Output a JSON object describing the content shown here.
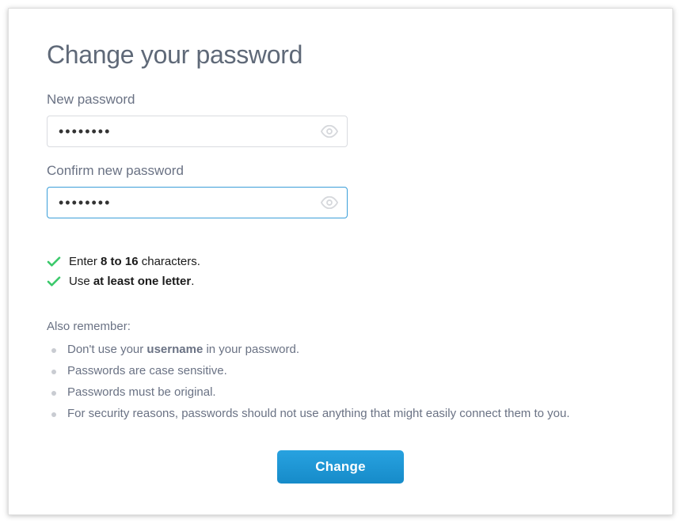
{
  "title": "Change your password",
  "fields": {
    "new_password": {
      "label": "New password",
      "value": "••••••••"
    },
    "confirm_password": {
      "label": "Confirm new password",
      "value": "••••••••"
    }
  },
  "rules": {
    "r1_pre": "Enter ",
    "r1_bold": "8 to 16",
    "r1_post": " characters.",
    "r2_pre": "Use ",
    "r2_bold": "at least one letter",
    "r2_post": "."
  },
  "remember": {
    "heading": "Also remember:",
    "tip1_pre": "Don't use your ",
    "tip1_bold": "username",
    "tip1_post": " in your password.",
    "tip2": "Passwords are case sensitive.",
    "tip3": "Passwords must be original.",
    "tip4": "For security reasons, passwords should not use anything that might easily connect them to you."
  },
  "button": {
    "change": "Change"
  }
}
